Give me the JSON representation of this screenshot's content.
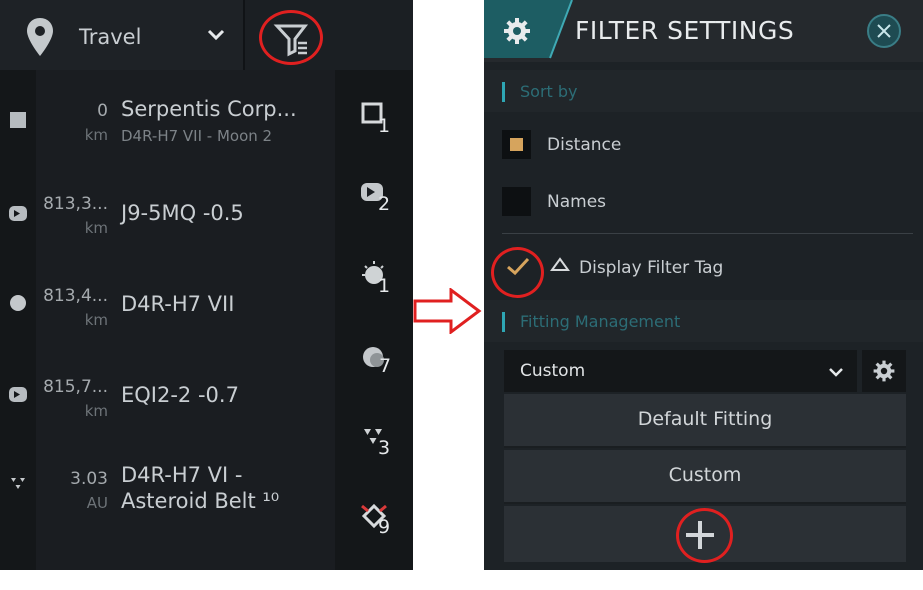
{
  "left_panel": {
    "travel_label": "Travel",
    "rows": [
      {
        "distance": "0",
        "unit": "km",
        "name": "Serpentis Corp...",
        "sub": "D4R-H7 VII - Moon 2",
        "count": "1"
      },
      {
        "distance": "813,3...",
        "unit": "km",
        "name": "J9-5MQ -0.5",
        "sub": "",
        "count": "2"
      },
      {
        "distance": "813,4...",
        "unit": "km",
        "name": "D4R-H7 VII",
        "sub": "",
        "count": "1"
      },
      {
        "distance": "815,7...",
        "unit": "km",
        "name": "EQI2-2 -0.7",
        "sub": "",
        "count": "7"
      },
      {
        "distance": "3.03",
        "unit": "AU",
        "name": "D4R-H7 VI -",
        "sub": "Asteroid Belt ¹⁰",
        "count": "3"
      },
      {
        "distance": "",
        "unit": "",
        "name": "",
        "sub": "",
        "count": "9"
      }
    ]
  },
  "filter_settings": {
    "title": "FILTER SETTINGS",
    "sort_by_header": "Sort by",
    "sort_options": [
      {
        "label": "Distance",
        "selected": true
      },
      {
        "label": "Names",
        "selected": false
      }
    ],
    "display_filter_tag_label": "Display Filter Tag",
    "display_filter_tag_checked": true,
    "fitting_header": "Fitting Management",
    "fitting_select_value": "Custom",
    "fitting_items": [
      "Default Fitting",
      "Custom"
    ]
  },
  "colors": {
    "accent": "#2ea6b4",
    "selected_option": "#d6a45d",
    "annotation_red": "#e02020"
  }
}
